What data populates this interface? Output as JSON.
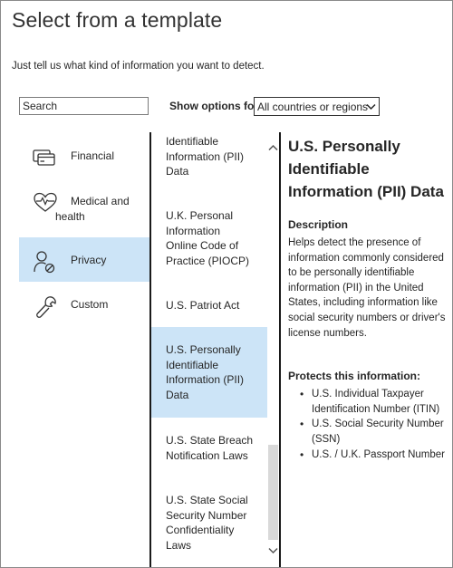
{
  "header": {
    "title": "Select from a template",
    "subtitle": "Just tell us what kind of information you want to detect."
  },
  "search": {
    "placeholder": "Search"
  },
  "filter": {
    "label": "Show options for",
    "selected": "All countries or regions"
  },
  "categories": [
    {
      "label": "Financial",
      "icon": "credit-card-icon"
    },
    {
      "label_line1": "Medical and",
      "label_line2": "health",
      "icon": "heart-pulse-icon"
    },
    {
      "label": "Privacy",
      "icon": "person-block-icon",
      "selected": true
    },
    {
      "label": "Custom",
      "icon": "wrench-icon"
    }
  ],
  "templates": [
    {
      "lines": [
        "Identifiable",
        "Information (PII)",
        "Data"
      ]
    },
    {
      "lines": [
        "U.K. Personal",
        "Information",
        "Online Code of",
        "Practice (PIOCP)"
      ]
    },
    {
      "lines": [
        "U.S. Patriot Act"
      ]
    },
    {
      "lines": [
        "U.S. Personally",
        "Identifiable",
        "Information (PII)",
        "Data"
      ],
      "selected": true
    },
    {
      "lines": [
        "U.S. State Breach",
        "Notification Laws"
      ]
    },
    {
      "lines": [
        "U.S. State Social",
        "Security Number",
        "Confidentiality",
        "Laws"
      ]
    }
  ],
  "details": {
    "title_lines": [
      "U.S. Personally",
      "Identifiable",
      "Information (PII) Data"
    ],
    "description_heading": "Description",
    "description_lines": [
      "Helps detect the presence of",
      "information commonly considered",
      "to be personally identifiable",
      "information (PII) in the United",
      "States, including information like",
      "social security numbers or driver's",
      "license numbers."
    ],
    "protects_heading": "Protects this information:",
    "protects_items": [
      [
        "U.S. Individual Taxpayer",
        "Identification Number (ITIN)"
      ],
      [
        "U.S. Social Security Number",
        "(SSN)"
      ],
      [
        "U.S. / U.K. Passport Number"
      ]
    ]
  },
  "colors": {
    "selection": "#cce4f7",
    "scroll_thumb": "#d9d9d9",
    "border": "#8a8a8a"
  }
}
